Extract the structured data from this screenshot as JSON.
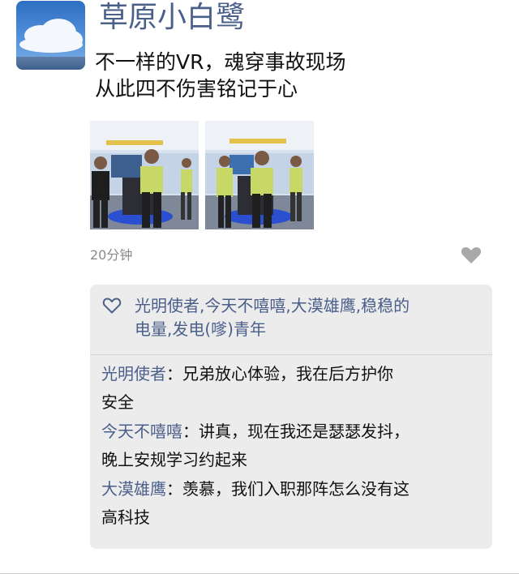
{
  "post": {
    "author": "草原小白鹭",
    "text_lines": [
      "不一样的VR，魂穿事故现场",
      "从此四不伤害铭记于心"
    ],
    "time": "20分钟"
  },
  "likes": {
    "line1": "光明使者,今天不嘻嘻,大漠雄鹰,稳稳的",
    "line2": "电量,发电(嗲)青年"
  },
  "comments": [
    {
      "author": "光明使者",
      "separator": "：",
      "line1": "兄弟放心体验，我在后方护你",
      "line2": "安全"
    },
    {
      "author": "今天不嘻嘻",
      "separator": "：",
      "line1": "讲真，现在我还是瑟瑟发抖，",
      "line2": "晚上安规学习约起来"
    },
    {
      "author": "大漠雄鹰",
      "separator": "：",
      "line1": "羡慕，我们入职那阵怎么没有这",
      "line2": "高科技"
    }
  ],
  "icons": {
    "like": "heart-outline-icon",
    "more": "heart-filled-icon"
  },
  "colors": {
    "name_blue": "#4a5f8a",
    "comment_bg": "#ececec",
    "time_gray": "#8a8a8a"
  }
}
